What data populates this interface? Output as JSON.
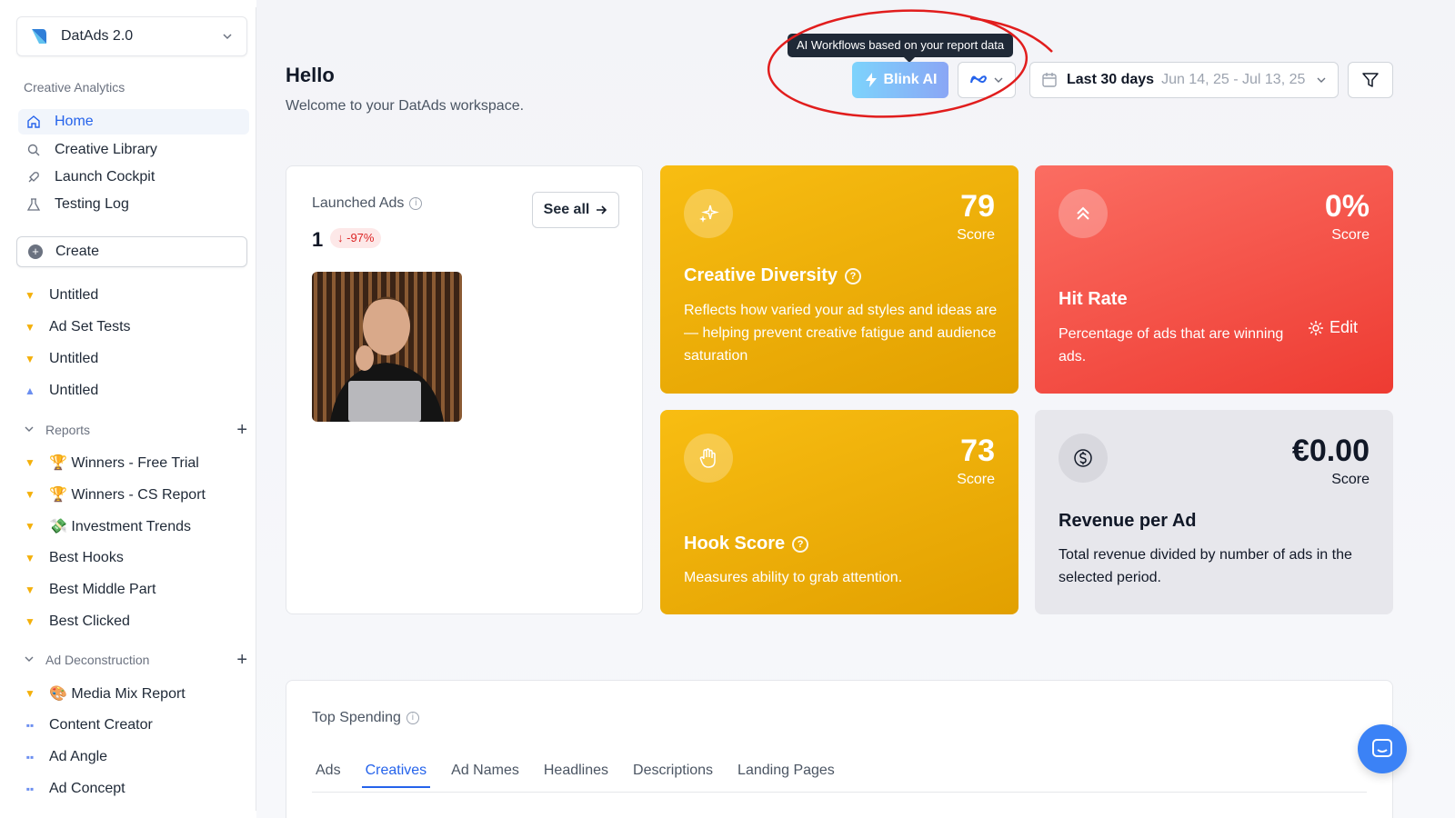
{
  "workspace": {
    "name": "DatAds 2.0"
  },
  "sidebar": {
    "section_label": "Creative Analytics",
    "nav": [
      {
        "label": "Home",
        "icon": "home-icon"
      },
      {
        "label": "Creative Library",
        "icon": "search-icon"
      },
      {
        "label": "Launch Cockpit",
        "icon": "rocket-icon"
      },
      {
        "label": "Testing Log",
        "icon": "flask-icon"
      }
    ],
    "create_label": "Create",
    "items": [
      {
        "label": "Untitled",
        "icon": "trophy-icon"
      },
      {
        "label": "Ad Set Tests",
        "icon": "trophy-icon"
      },
      {
        "label": "Untitled",
        "icon": "trophy-icon"
      },
      {
        "label": "Untitled",
        "icon": "flask-icon"
      }
    ],
    "reports_label": "Reports",
    "reports": [
      {
        "label": "🏆 Winners - Free Trial"
      },
      {
        "label": "🏆 Winners - CS Report"
      },
      {
        "label": "💸 Investment Trends"
      },
      {
        "label": "Best Hooks"
      },
      {
        "label": "Best Middle Part"
      },
      {
        "label": "Best Clicked"
      }
    ],
    "deconstruction_label": "Ad Deconstruction",
    "deconstruction": [
      {
        "label": "🎨 Media Mix Report",
        "icon": "trophy-icon"
      },
      {
        "label": "Content Creator",
        "icon": "tag-icon"
      },
      {
        "label": "Ad Angle",
        "icon": "tag-icon"
      },
      {
        "label": "Ad Concept",
        "icon": "tag-icon"
      }
    ]
  },
  "header": {
    "title": "Hello",
    "subtitle": "Welcome to your DatAds workspace.",
    "tooltip": "AI Workflows based on your report data",
    "blink_label": "Blink AI",
    "date_label": "Last 30 days",
    "date_range": "Jun 14, 25 - Jul 13, 25"
  },
  "launched": {
    "title": "Launched Ads",
    "see_all": "See all",
    "count": "1",
    "change": "↓ -97%"
  },
  "cards": {
    "diversity": {
      "value": "79",
      "unit": "Score",
      "title": "Creative Diversity",
      "desc": "Reflects how varied your ad styles and ideas are — helping prevent creative fatigue and audience saturation"
    },
    "hit": {
      "value": "0%",
      "unit": "Score",
      "title": "Hit Rate",
      "desc": "Percentage of ads that are winning ads.",
      "edit": "Edit"
    },
    "hook": {
      "value": "73",
      "unit": "Score",
      "title": "Hook Score",
      "desc": "Measures ability to grab attention."
    },
    "revenue": {
      "value": "€0.00",
      "unit": "Score",
      "title": "Revenue per Ad",
      "desc": "Total revenue divided by number of ads in the selected period."
    }
  },
  "top_spending": {
    "title": "Top Spending",
    "tabs": [
      "Ads",
      "Creatives",
      "Ad Names",
      "Headlines",
      "Descriptions",
      "Landing Pages"
    ],
    "active_tab": "Creatives"
  },
  "colors": {
    "accent": "#2563eb",
    "amber": "#f4b00b",
    "red": "#f5564c",
    "annotation": "#e11d1d"
  }
}
